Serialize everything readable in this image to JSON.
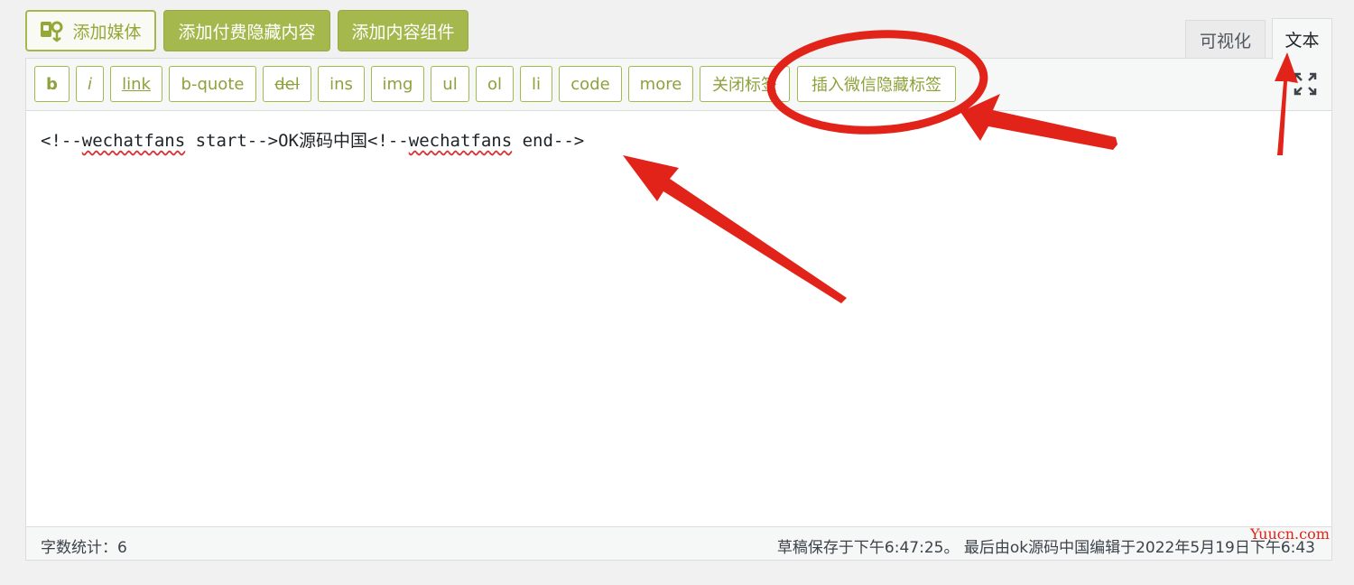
{
  "media_buttons": {
    "add_media": "添加媒体",
    "add_paid_hidden": "添加付费隐藏内容",
    "add_content_block": "添加内容组件"
  },
  "tabs": {
    "visual": "可视化",
    "text": "文本"
  },
  "quicktags": {
    "b": "b",
    "i": "i",
    "link": "link",
    "bquote": "b-quote",
    "del": "del",
    "ins": "ins",
    "img": "img",
    "ul": "ul",
    "ol": "ol",
    "li": "li",
    "code": "code",
    "more": "more",
    "close_tags": "关闭标签",
    "insert_wechat": "插入微信隐藏标签"
  },
  "content": {
    "part1": "<!--",
    "tag1": "wechatfans",
    "part2": " start-->OK源码中国<!--",
    "tag2": "wechatfans",
    "part3": " end-->"
  },
  "status": {
    "word_count": "字数统计：6",
    "autosave": "草稿保存于下午6:47:25。 最后由ok源码中国编辑于2022年5月19日下午6:43"
  },
  "watermark": "Yuucn.com",
  "colors": {
    "accent": "#a4b84e",
    "annotation": "#e2231a"
  },
  "icons": {
    "add_media": "media-icon",
    "fullscreen": "fullscreen-icon"
  }
}
